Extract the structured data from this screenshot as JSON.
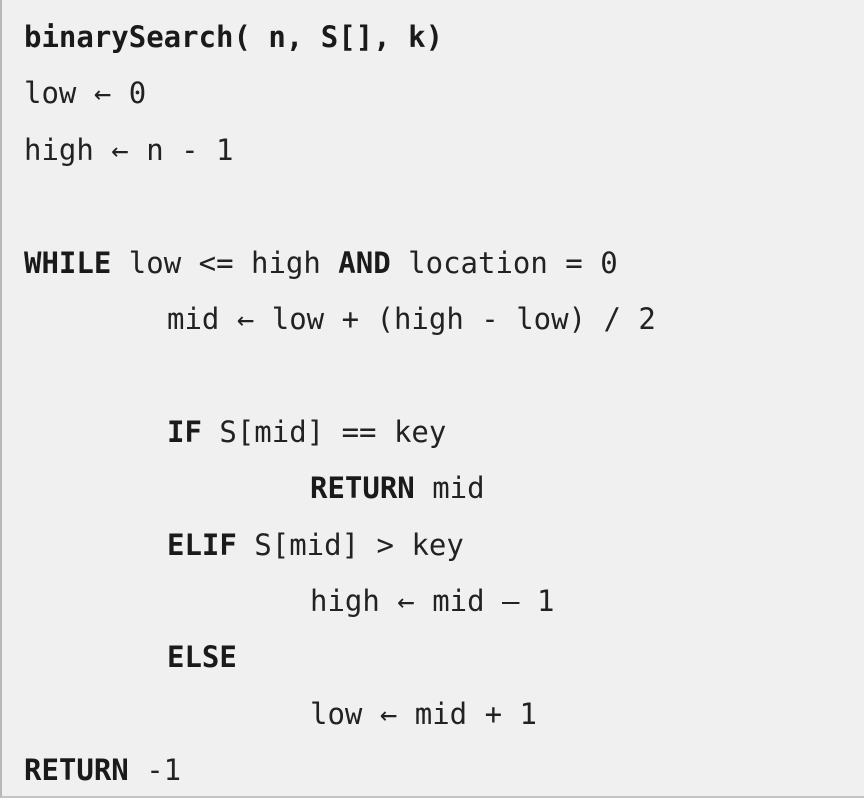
{
  "code": {
    "lines": [
      {
        "indent": 0,
        "tokens": [
          {
            "text": "binarySearch( n, S[], k)",
            "bold": true
          }
        ]
      },
      {
        "indent": 0,
        "tokens": [
          {
            "text": "low ← 0",
            "bold": false
          }
        ]
      },
      {
        "indent": 0,
        "tokens": [
          {
            "text": "high ← n - 1",
            "bold": false
          }
        ]
      },
      {
        "indent": 0,
        "tokens": []
      },
      {
        "indent": 0,
        "tokens": [
          {
            "text": "WHILE",
            "bold": true
          },
          {
            "text": " low <= high ",
            "bold": false
          },
          {
            "text": "AND",
            "bold": true
          },
          {
            "text": " location = 0",
            "bold": false
          }
        ]
      },
      {
        "indent": 1,
        "tokens": [
          {
            "text": "mid ← low + (high - low) / 2",
            "bold": false
          }
        ]
      },
      {
        "indent": 0,
        "tokens": []
      },
      {
        "indent": 1,
        "tokens": [
          {
            "text": "IF",
            "bold": true
          },
          {
            "text": " S[mid] == key",
            "bold": false
          }
        ]
      },
      {
        "indent": 2,
        "tokens": [
          {
            "text": "RETURN",
            "bold": true
          },
          {
            "text": " mid",
            "bold": false
          }
        ]
      },
      {
        "indent": 1,
        "tokens": [
          {
            "text": "ELIF",
            "bold": true
          },
          {
            "text": " S[mid] > key",
            "bold": false
          }
        ]
      },
      {
        "indent": 2,
        "tokens": [
          {
            "text": "high ← mid – 1",
            "bold": false
          }
        ]
      },
      {
        "indent": 1,
        "tokens": [
          {
            "text": "ELSE",
            "bold": true
          }
        ]
      },
      {
        "indent": 2,
        "tokens": [
          {
            "text": "low ← mid + 1",
            "bold": false
          }
        ]
      },
      {
        "indent": 0,
        "tokens": [
          {
            "text": "RETURN",
            "bold": true
          },
          {
            "text": " -1",
            "bold": false
          }
        ]
      }
    ]
  }
}
